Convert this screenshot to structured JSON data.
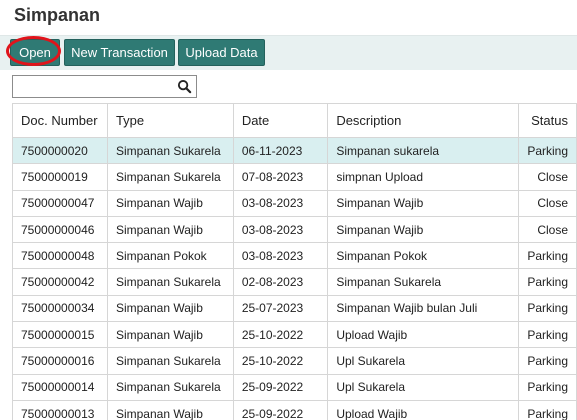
{
  "page": {
    "title": "Simpanan"
  },
  "toolbar": {
    "open_label": "Open",
    "new_transaction_label": "New Transaction",
    "upload_data_label": "Upload Data"
  },
  "search": {
    "value": "",
    "icon": "search-icon"
  },
  "colors": {
    "toolbar_bg": "#e8f1f1",
    "button_bg": "#2f7a74",
    "selected_row_bg": "#d9eff0",
    "highlight": "#e0141b"
  },
  "table": {
    "columns": [
      "Doc. Number",
      "Type",
      "Date",
      "Description",
      "Status"
    ],
    "rows": [
      [
        "7500000020",
        "Simpanan Sukarela",
        "06-11-2023",
        "Simpanan sukarela",
        "Parking"
      ],
      [
        "7500000019",
        "Simpanan Sukarela",
        "07-08-2023",
        "simpnan Upload",
        "Close"
      ],
      [
        "75000000047",
        "Simpanan Wajib",
        "03-08-2023",
        "Simpanan Wajib",
        "Close"
      ],
      [
        "75000000046",
        "Simpanan Wajib",
        "03-08-2023",
        "Simpanan Wajib",
        "Close"
      ],
      [
        "75000000048",
        "Simpanan Pokok",
        "03-08-2023",
        "Simpanan Pokok",
        "Parking"
      ],
      [
        "75000000042",
        "Simpanan Sukarela",
        "02-08-2023",
        "Simpanan Sukarela",
        "Parking"
      ],
      [
        "75000000034",
        "Simpanan Wajib",
        "25-07-2023",
        "Simpanan Wajib bulan Juli",
        "Parking"
      ],
      [
        "75000000015",
        "Simpanan Wajib",
        "25-10-2022",
        "Upload Wajib",
        "Parking"
      ],
      [
        "75000000016",
        "Simpanan Sukarela",
        "25-10-2022",
        "Upl Sukarela",
        "Parking"
      ],
      [
        "75000000014",
        "Simpanan Sukarela",
        "25-09-2022",
        "Upl Sukarela",
        "Parking"
      ],
      [
        "75000000013",
        "Simpanan Wajib",
        "25-09-2022",
        "Upload Wajib",
        "Parking"
      ]
    ],
    "selected_row": 0
  }
}
